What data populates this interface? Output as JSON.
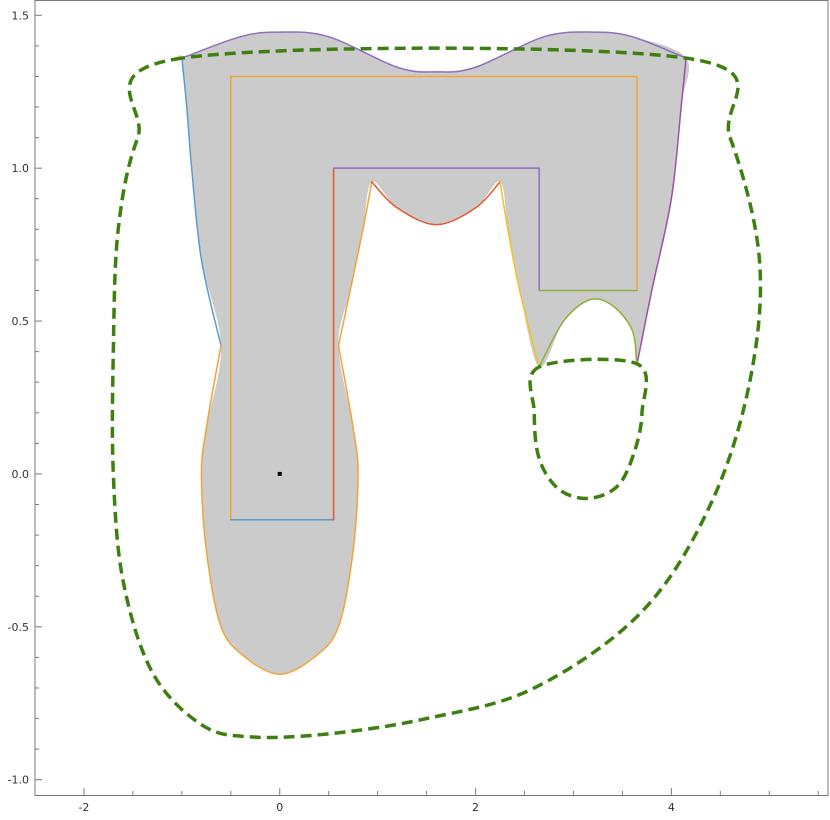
{
  "chart_data": {
    "type": "region-plot",
    "xlim": [
      -2.5,
      5.6
    ],
    "ylim": [
      -1.05,
      1.55
    ],
    "x_ticks": [
      {
        "value": -2,
        "label": "-2"
      },
      {
        "value": 0,
        "label": "0"
      },
      {
        "value": 2,
        "label": "2"
      },
      {
        "value": 4,
        "label": "4"
      }
    ],
    "y_ticks": [
      {
        "value": 1.5,
        "label": "1.5"
      },
      {
        "value": 1.0,
        "label": "1.0"
      },
      {
        "value": 0.5,
        "label": "0.5"
      },
      {
        "value": 0.0,
        "label": "0.0"
      },
      {
        "value": -0.5,
        "label": "-0.5"
      },
      {
        "value": -1.0,
        "label": "-1.0"
      }
    ],
    "grid": false,
    "colors": {
      "region_fill": "#cbcbcb",
      "dashed_curve": "#3d8010",
      "blue": "#5e9bd1",
      "orange": "#f1a43a",
      "purple": "#8e6fc0",
      "red": "#e2582c",
      "yellow": "#f5c021",
      "green": "#8bb13a",
      "magenta": "#a04fa8"
    },
    "region_boundary": [
      [
        -1.0,
        1.36
      ],
      [
        -0.4,
        1.43
      ],
      [
        0.0,
        1.445
      ],
      [
        0.5,
        1.43
      ],
      [
        1.2,
        1.33
      ],
      [
        1.6,
        1.315
      ],
      [
        2.0,
        1.33
      ],
      [
        2.7,
        1.43
      ],
      [
        3.2,
        1.445
      ],
      [
        3.6,
        1.43
      ],
      [
        4.15,
        1.36
      ],
      [
        4.1,
        1.2
      ],
      [
        4.0,
        0.9
      ],
      [
        3.8,
        0.6
      ],
      [
        3.65,
        0.36
      ],
      [
        3.6,
        0.47
      ],
      [
        3.4,
        0.55
      ],
      [
        3.17,
        0.57
      ],
      [
        2.9,
        0.5
      ],
      [
        2.65,
        0.35
      ],
      [
        2.45,
        0.6
      ],
      [
        2.33,
        0.8
      ],
      [
        2.25,
        0.955
      ],
      [
        2.0,
        0.87
      ],
      [
        1.6,
        0.815
      ],
      [
        1.2,
        0.87
      ],
      [
        0.94,
        0.955
      ],
      [
        0.85,
        0.8
      ],
      [
        0.72,
        0.6
      ],
      [
        0.6,
        0.42
      ],
      [
        0.75,
        0.15
      ],
      [
        0.8,
        0.0
      ],
      [
        0.75,
        -0.25
      ],
      [
        0.6,
        -0.5
      ],
      [
        0.35,
        -0.6
      ],
      [
        0.0,
        -0.655
      ],
      [
        -0.35,
        -0.6
      ],
      [
        -0.6,
        -0.5
      ],
      [
        -0.75,
        -0.25
      ],
      [
        -0.8,
        0.0
      ],
      [
        -0.75,
        0.15
      ],
      [
        -0.6,
        0.42
      ],
      [
        -0.8,
        0.7
      ],
      [
        -0.9,
        1.0
      ],
      [
        -0.95,
        1.2
      ],
      [
        -1.0,
        1.36
      ]
    ],
    "curves": [
      {
        "name": "blue-left",
        "color": "#5e9bd1",
        "width": 1.5,
        "points": [
          [
            -1.0,
            1.36
          ],
          [
            -0.95,
            1.2
          ],
          [
            -0.9,
            1.0
          ],
          [
            -0.8,
            0.7
          ],
          [
            -0.6,
            0.42
          ]
        ]
      },
      {
        "name": "purple-top",
        "color": "#8e6fc0",
        "width": 1.5,
        "points": [
          [
            -1.0,
            1.36
          ],
          [
            -0.4,
            1.43
          ],
          [
            0.0,
            1.445
          ],
          [
            0.5,
            1.43
          ],
          [
            1.2,
            1.33
          ],
          [
            1.6,
            1.315
          ],
          [
            2.0,
            1.33
          ],
          [
            2.7,
            1.43
          ],
          [
            3.2,
            1.445
          ],
          [
            3.6,
            1.43
          ],
          [
            4.15,
            1.36
          ]
        ]
      },
      {
        "name": "magenta-right",
        "color": "#a04fa8",
        "width": 1.5,
        "points": [
          [
            4.15,
            1.36
          ],
          [
            4.1,
            1.2
          ],
          [
            4.0,
            0.9
          ],
          [
            3.8,
            0.6
          ],
          [
            3.65,
            0.36
          ]
        ]
      },
      {
        "name": "orange-ellipse",
        "color": "#f1a43a",
        "width": 1.5,
        "points": [
          [
            -0.6,
            0.42
          ],
          [
            -0.75,
            0.15
          ],
          [
            -0.8,
            0.0
          ],
          [
            -0.75,
            -0.25
          ],
          [
            -0.6,
            -0.5
          ],
          [
            -0.35,
            -0.6
          ],
          [
            0.0,
            -0.655
          ],
          [
            0.35,
            -0.6
          ],
          [
            0.6,
            -0.5
          ],
          [
            0.75,
            -0.25
          ],
          [
            0.8,
            0.0
          ],
          [
            0.75,
            0.15
          ],
          [
            0.6,
            0.42
          ]
        ]
      },
      {
        "name": "orange-inner-left",
        "color": "#f1a43a",
        "width": 1.5,
        "points": [
          [
            0.6,
            0.42
          ],
          [
            0.72,
            0.6
          ],
          [
            0.85,
            0.8
          ],
          [
            0.94,
            0.955
          ]
        ]
      },
      {
        "name": "red-arc",
        "color": "#e2582c",
        "width": 1.5,
        "points": [
          [
            0.94,
            0.955
          ],
          [
            1.2,
            0.87
          ],
          [
            1.6,
            0.815
          ],
          [
            2.0,
            0.87
          ],
          [
            2.25,
            0.955
          ]
        ]
      },
      {
        "name": "yellow-inner-right",
        "color": "#f5c021",
        "width": 1.5,
        "points": [
          [
            2.25,
            0.955
          ],
          [
            2.33,
            0.8
          ],
          [
            2.45,
            0.6
          ],
          [
            2.65,
            0.35
          ]
        ]
      },
      {
        "name": "green-arc",
        "color": "#8bb13a",
        "width": 1.5,
        "points": [
          [
            2.65,
            0.35
          ],
          [
            2.9,
            0.5
          ],
          [
            3.17,
            0.57
          ],
          [
            3.4,
            0.55
          ],
          [
            3.6,
            0.47
          ],
          [
            3.65,
            0.36
          ]
        ]
      },
      {
        "name": "orange-polygon-outer",
        "color": "#f1a43a",
        "width": 1.5,
        "points": [
          [
            -0.5,
            -0.15
          ],
          [
            -0.5,
            1.3
          ],
          [
            3.65,
            1.3
          ],
          [
            3.65,
            0.6
          ]
        ]
      },
      {
        "name": "blue-polygon-bottom",
        "color": "#5e9bd1",
        "width": 1.5,
        "points": [
          [
            -0.5,
            -0.15
          ],
          [
            0.55,
            -0.15
          ]
        ]
      },
      {
        "name": "red-polygon-inner",
        "color": "#e2582c",
        "width": 1.5,
        "points": [
          [
            0.55,
            -0.15
          ],
          [
            0.55,
            1.0
          ]
        ]
      },
      {
        "name": "purple-polygon-inner",
        "color": "#8e6fc0",
        "width": 1.5,
        "points": [
          [
            0.55,
            1.0
          ],
          [
            2.65,
            1.0
          ],
          [
            2.65,
            0.6
          ]
        ]
      },
      {
        "name": "green-polygon-step",
        "color": "#8bb13a",
        "width": 1.5,
        "points": [
          [
            2.65,
            0.6
          ],
          [
            3.65,
            0.6
          ]
        ]
      }
    ],
    "dashed_curves": [
      {
        "name": "outer-dashed-loop",
        "color": "#3d8010",
        "width": 3.5,
        "closed": true,
        "points": [
          [
            -1.0,
            1.36
          ],
          [
            -1.45,
            1.1
          ],
          [
            -1.65,
            0.8
          ],
          [
            -1.7,
            0.4
          ],
          [
            -1.7,
            0.0
          ],
          [
            -1.6,
            -0.35
          ],
          [
            -1.3,
            -0.65
          ],
          [
            -0.8,
            -0.82
          ],
          [
            -0.3,
            -0.86
          ],
          [
            0.5,
            -0.85
          ],
          [
            1.5,
            -0.8
          ],
          [
            2.6,
            -0.7
          ],
          [
            3.7,
            -0.45
          ],
          [
            4.4,
            -0.1
          ],
          [
            4.8,
            0.3
          ],
          [
            4.9,
            0.7
          ],
          [
            4.6,
            1.1
          ],
          [
            4.15,
            1.36
          ]
        ]
      },
      {
        "name": "inner-dashed-loop",
        "color": "#3d8010",
        "width": 3.5,
        "closed": true,
        "points": [
          [
            2.65,
            0.35
          ],
          [
            2.6,
            0.2
          ],
          [
            2.65,
            0.05
          ],
          [
            2.85,
            -0.05
          ],
          [
            3.15,
            -0.08
          ],
          [
            3.45,
            -0.04
          ],
          [
            3.62,
            0.07
          ],
          [
            3.7,
            0.2
          ],
          [
            3.65,
            0.36
          ]
        ]
      }
    ],
    "marker": {
      "x": 0.0,
      "y": 0.0,
      "color": "#000000"
    },
    "xlabel": "",
    "ylabel": "",
    "title": ""
  }
}
